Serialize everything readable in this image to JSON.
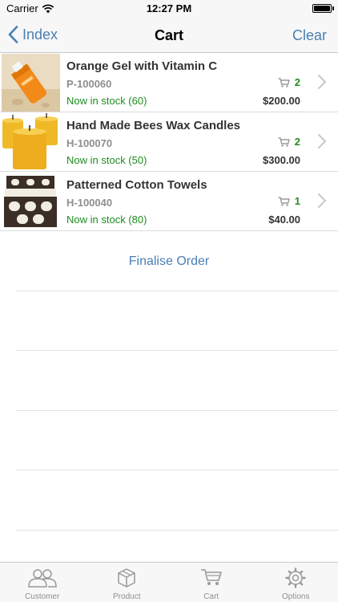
{
  "status_bar": {
    "carrier": "Carrier",
    "time": "12:27 PM"
  },
  "nav": {
    "back_label": "Index",
    "title": "Cart",
    "clear_label": "Clear"
  },
  "cart_items": [
    {
      "name": "Orange Gel with Vitamin C",
      "sku": "P-100060",
      "stock": "Now in stock (60)",
      "quantity": "2",
      "price": "$200.00"
    },
    {
      "name": "Hand Made Bees Wax Candles",
      "sku": "H-100070",
      "stock": "Now in stock (50)",
      "quantity": "2",
      "price": "$300.00"
    },
    {
      "name": "Patterned Cotton Towels",
      "sku": "H-100040",
      "stock": "Now in stock (80)",
      "quantity": "1",
      "price": "$40.00"
    }
  ],
  "finalise_label": "Finalise Order",
  "tabs": [
    {
      "label": "Customer",
      "icon": "customer-icon"
    },
    {
      "label": "Product",
      "icon": "product-box-icon"
    },
    {
      "label": "Cart",
      "icon": "cart-icon"
    },
    {
      "label": "Options",
      "icon": "gear-icon"
    }
  ],
  "colors": {
    "accent": "#4a7fb5",
    "in_stock": "#1f8c1f",
    "nav_bg": "#f7f7f7"
  }
}
